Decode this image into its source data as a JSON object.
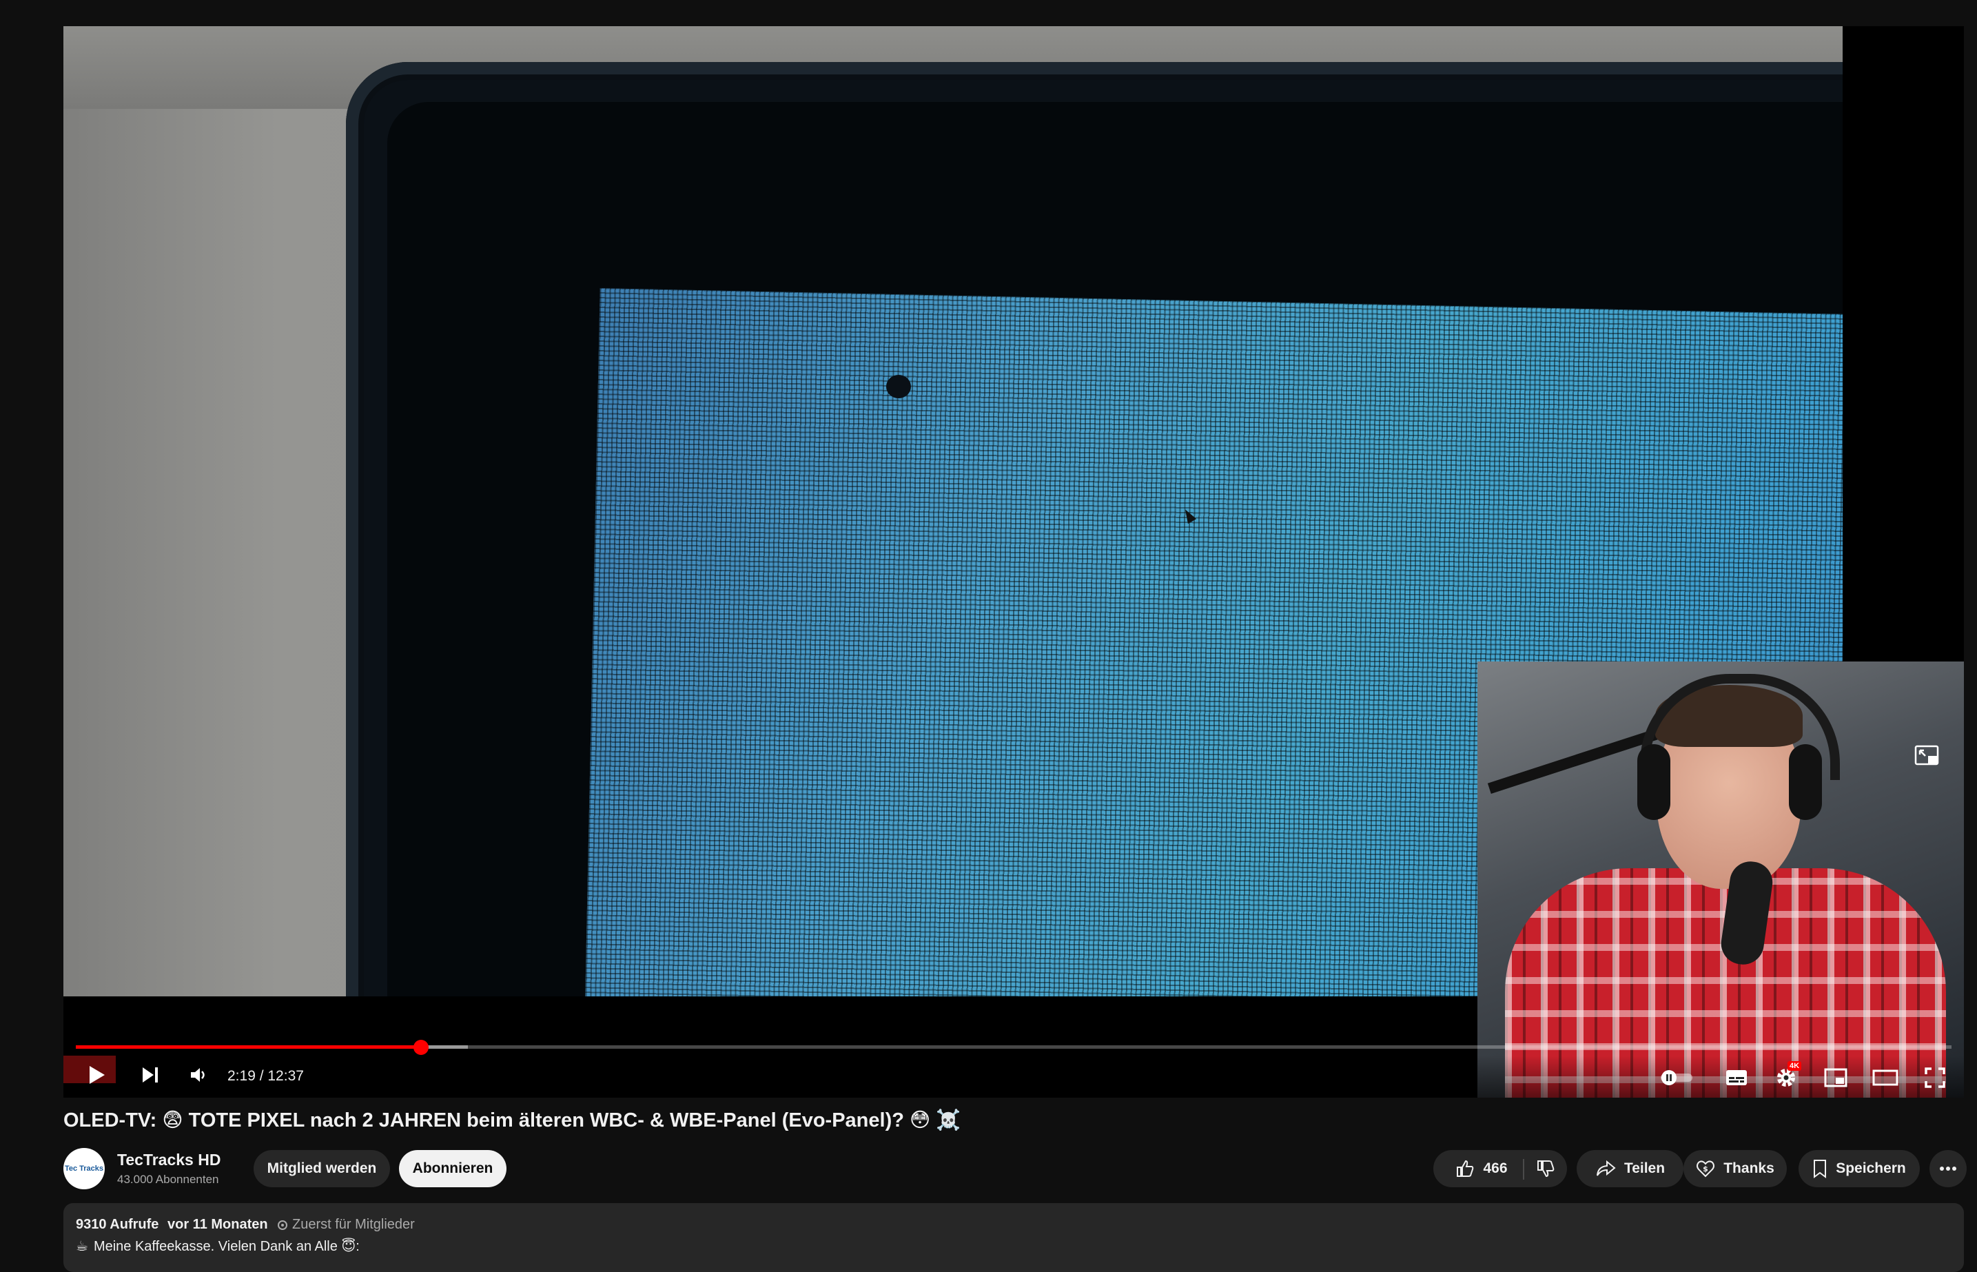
{
  "player": {
    "current_time": "2:19",
    "duration": "12:37",
    "time_text": "2:19 / 12:37",
    "progress_fraction": 0.184,
    "buffer_fraction": 0.209,
    "quality_badge": "4K"
  },
  "video": {
    "title": "OLED-TV: 😨 TOTE PIXEL nach 2 JAHREN beim älteren WBC- & WBE-Panel (Evo-Panel)? 😳 ☠️"
  },
  "channel": {
    "avatar_text": "Tec Tracks",
    "name": "TecTracks HD",
    "subscribers": "43.000 Abonnenten"
  },
  "actions": {
    "join_label": "Mitglied werden",
    "subscribe_label": "Abonnieren",
    "like_count": "466",
    "share_label": "Teilen",
    "thanks_label": "Thanks",
    "save_label": "Speichern"
  },
  "description": {
    "views": "9310 Aufrufe",
    "date": "vor 11 Monaten",
    "members_first": "Zuerst für Mitglieder",
    "first_line": "Meine Kaffeekasse. Vielen Dank an Alle 😇:",
    "first_line_icon": "☕"
  },
  "colors": {
    "accent": "#ff0000",
    "background": "#0f0f0f",
    "chip": "#272727"
  }
}
